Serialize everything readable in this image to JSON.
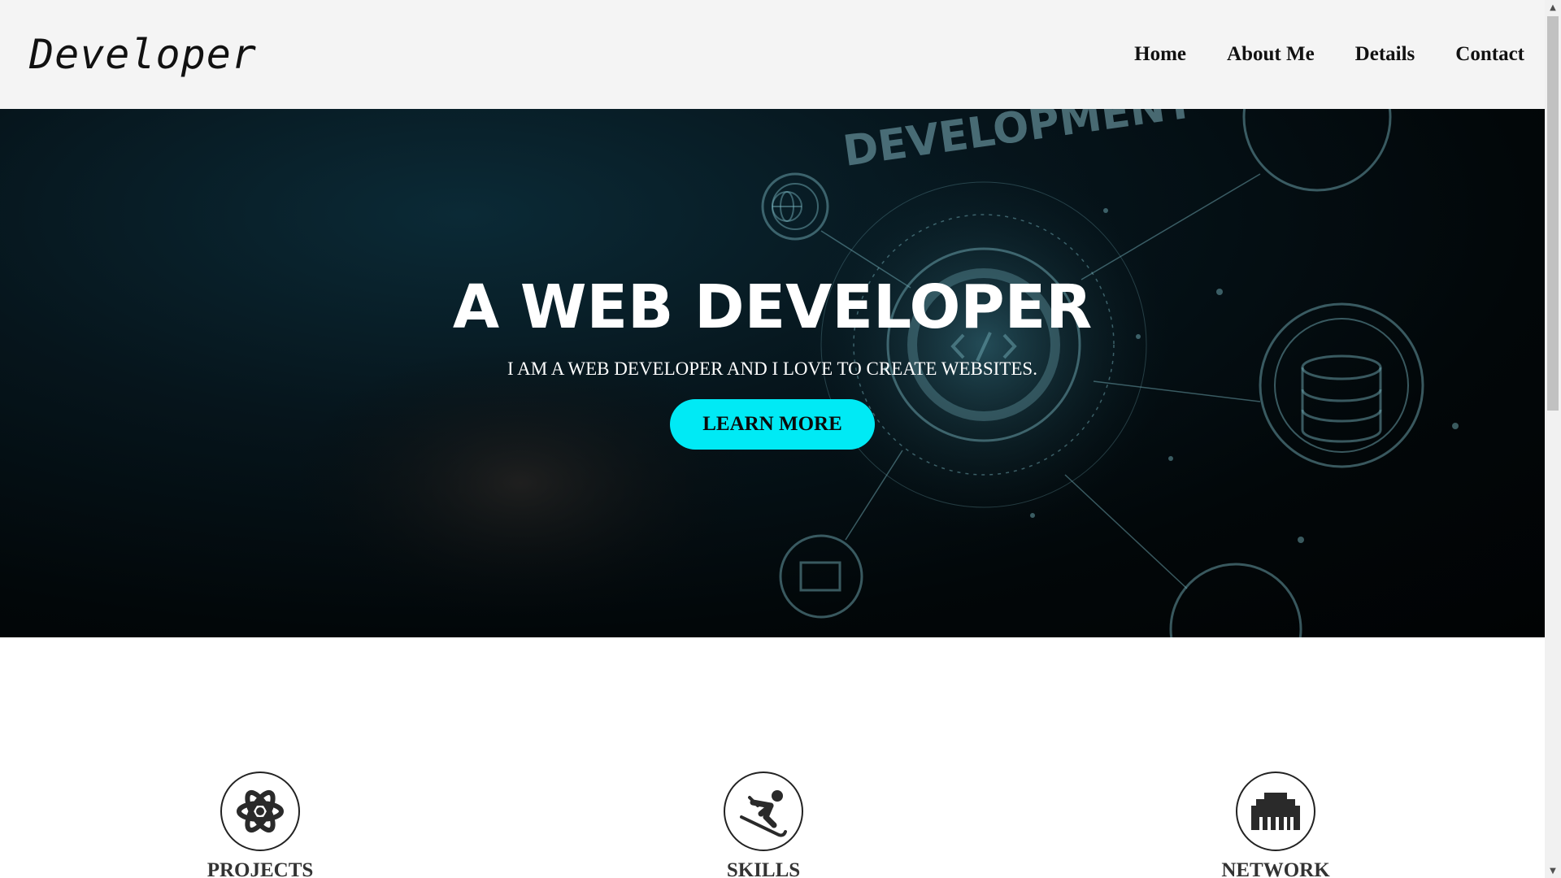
{
  "header": {
    "logo": "Developer",
    "nav": [
      "Home",
      "About Me",
      "Details",
      "Contact"
    ]
  },
  "hero": {
    "title": "A WEB DEVELOPER",
    "subtitle": "I AM A WEB DEVELOPER AND I LOVE TO CREATE WEBSITES.",
    "button": "LEARN MORE",
    "background_text": "DEVELOPMENT"
  },
  "features": [
    {
      "label": "PROJECTS",
      "icon": "atom-icon"
    },
    {
      "label": "SKILLS",
      "icon": "skier-icon"
    },
    {
      "label": "NETWORK",
      "icon": "ethernet-icon"
    }
  ],
  "colors": {
    "accent": "#00eaf5",
    "header_bg": "#f4f4f4",
    "hero_bg": "#020709"
  }
}
